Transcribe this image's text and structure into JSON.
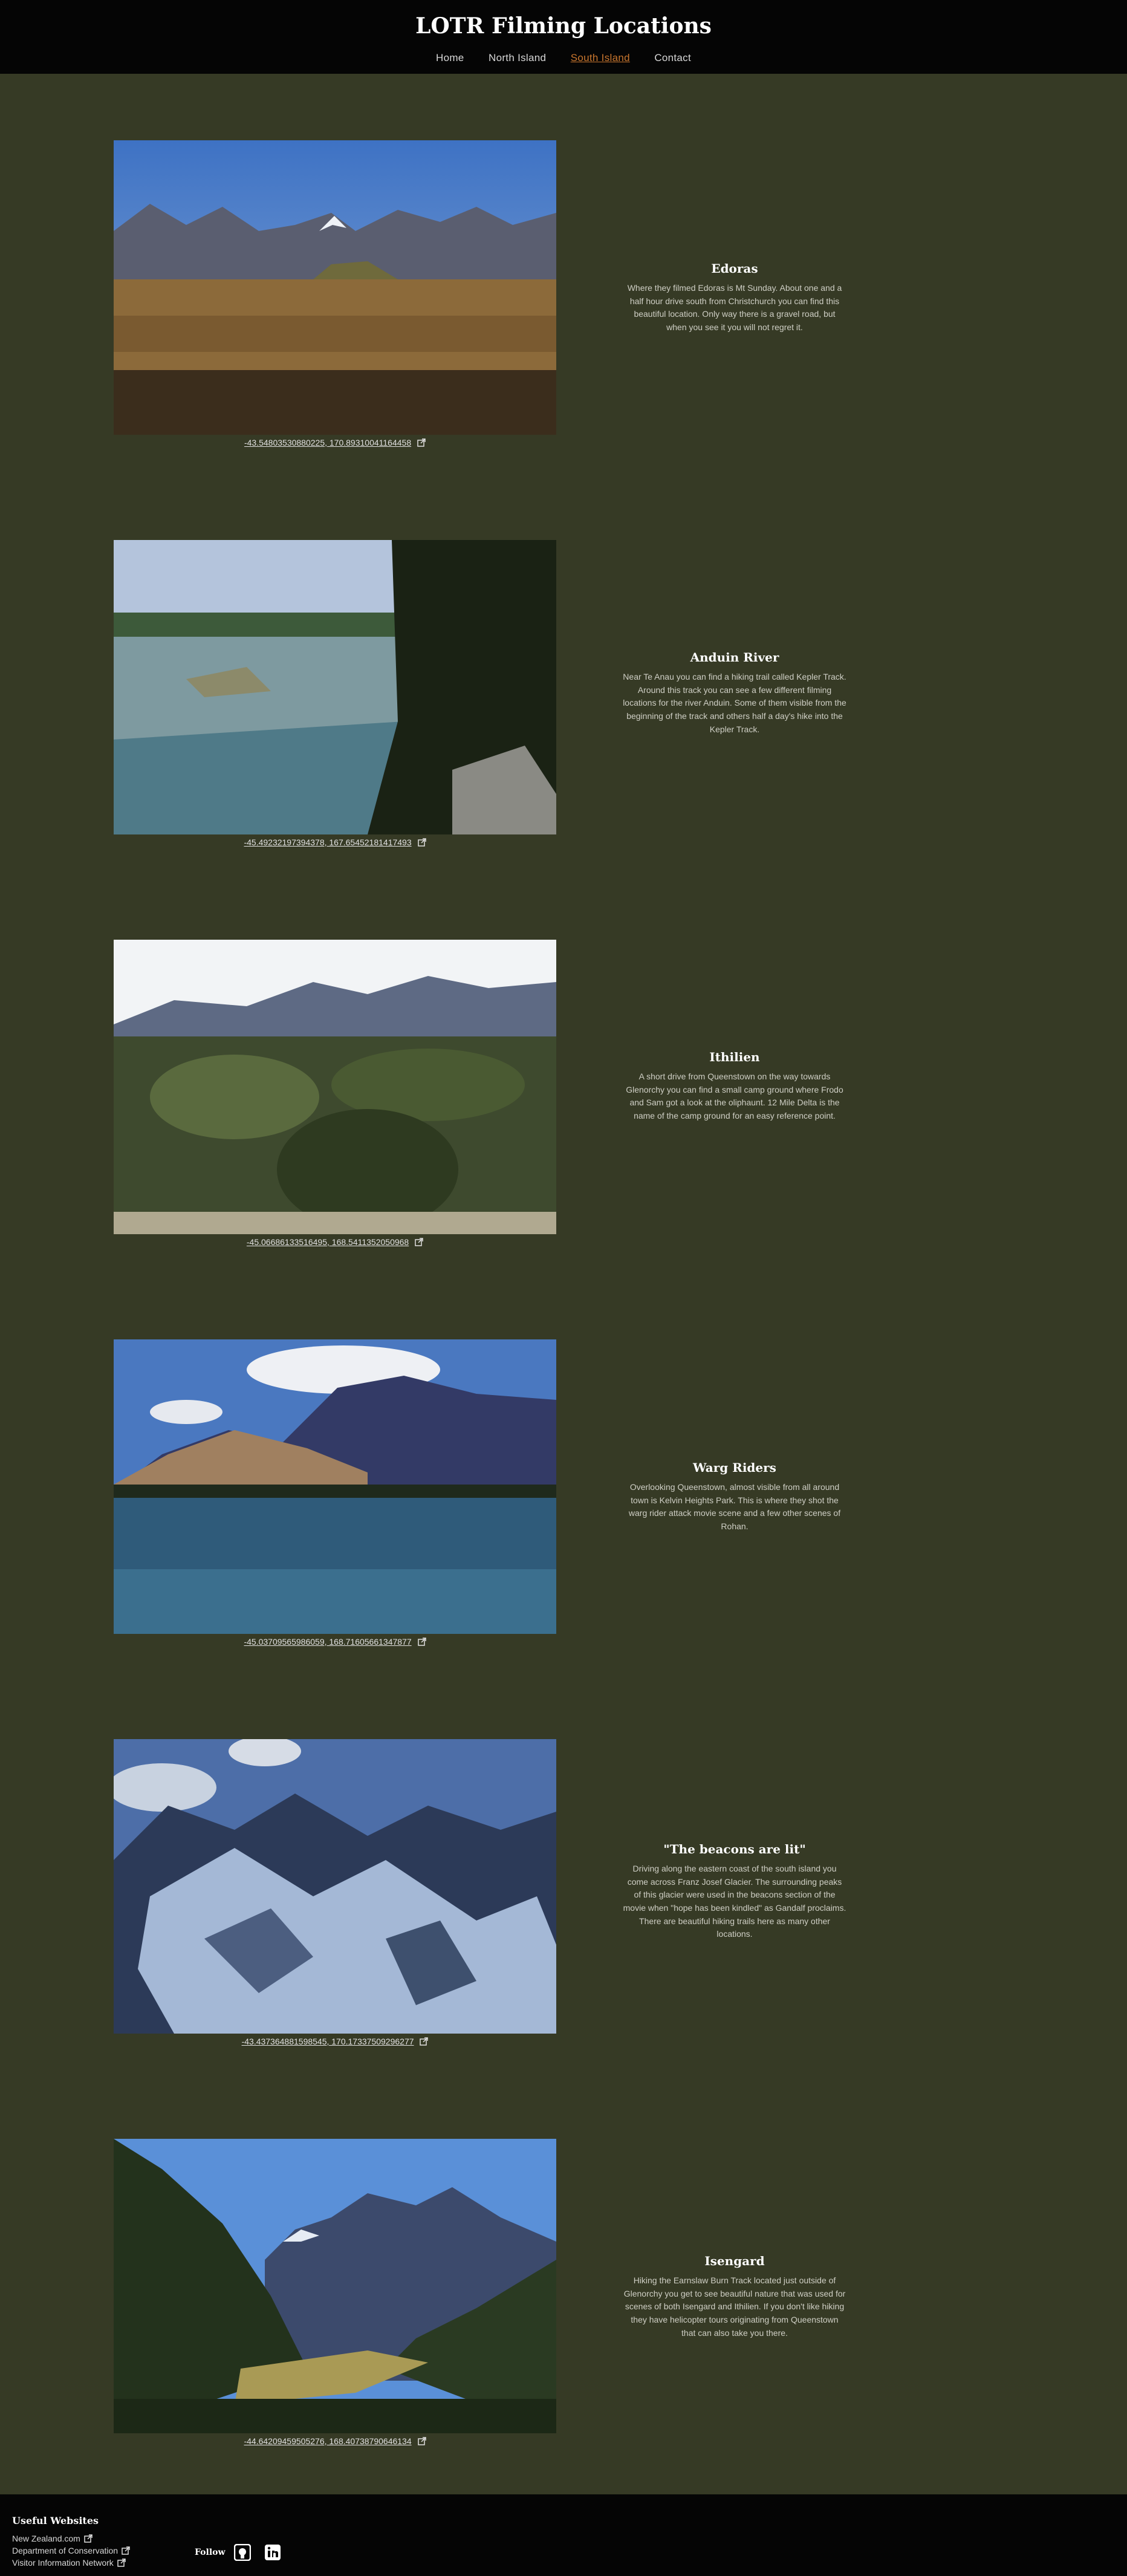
{
  "site": {
    "title": "LOTR Filming Locations"
  },
  "nav": [
    {
      "label": "Home",
      "active": false
    },
    {
      "label": "North Island",
      "active": false
    },
    {
      "label": "South Island",
      "active": true
    },
    {
      "label": "Contact",
      "active": false
    }
  ],
  "locations": [
    {
      "title": "Edoras",
      "coords": "-43.54803530880225, 170.89310041164458",
      "description": "Where they filmed Edoras is Mt Sunday. About one and a half hour drive south from Christchurch you can find this beautiful location. Only way there is a gravel road, but when you see it you will not regret it."
    },
    {
      "title": "Anduin River",
      "coords": "-45.49232197394378, 167.65452181417493",
      "description": "Near Te Anau you can find a hiking trail called Kepler Track. Around this track you can see a few different filming locations for the river Anduin. Some of them visible from the beginning of the track and others half a day's hike into the Kepler Track."
    },
    {
      "title": "Ithilien",
      "coords": "-45.06686133516495, 168.54113520509​68",
      "description": "A short drive from Queenstown on the way towards Glenorchy you can find a small camp ground where Frodo and Sam got a look at the oliphaunt. 12 Mile Delta is the name of the camp ground for an easy reference point."
    },
    {
      "title": "Warg Riders",
      "coords": "-45.03709565986059, 168.71605661347877",
      "description": "Overlooking Queenstown, almost visible from all around town is Kelvin Heights Park. This is where they shot the warg rider attack movie scene and a few other scenes of Rohan."
    },
    {
      "title": "\"The beacons are lit\"",
      "coords": "-43.43736488159854​5, 170.17337509296277",
      "description": "Driving along the eastern coast of the south island you come across Franz Josef Glacier. The surrounding peaks of this glacier were used in the beacons section of the movie when \"hope has been kindled\" as Gandalf proclaims. There are beautiful hiking trails here as many other locations."
    },
    {
      "title": "Isengard",
      "coords": "-44.64209459505276, 168.40738790646134",
      "description": "Hiking the Earnslaw Burn Track located just outside of Glenorchy you get to see beautiful nature that was used for scenes of both Isengard and Ithilien. If you don't like hiking they have helicopter tours originating from Queenstown that can also take you there."
    }
  ],
  "footer": {
    "useful_title": "Useful Websites",
    "links": [
      "New Zealand.com",
      "Department of Conservation",
      "Visitor Information Network"
    ],
    "follow_label": "Follow",
    "social_icons": [
      "github-icon",
      "linkedin-icon"
    ]
  }
}
